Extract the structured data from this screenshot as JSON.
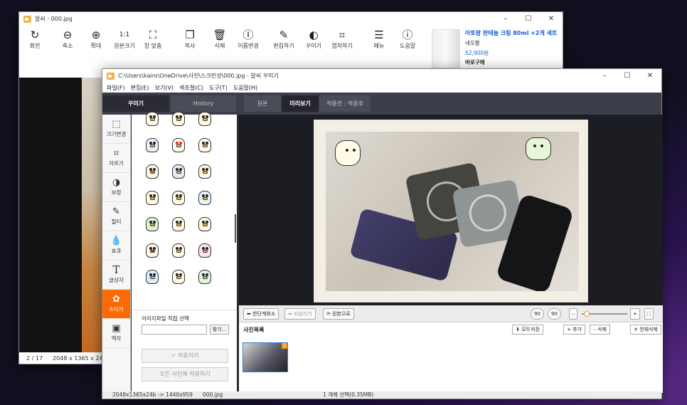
{
  "back_window": {
    "title": "알씨 - 000.jpg",
    "controls": [
      "–",
      "☐",
      "✕"
    ],
    "toolbar": [
      {
        "label": "회전",
        "icon": "rotate-icon",
        "glyph": "↻"
      },
      {
        "label": "축소",
        "icon": "zoom-out-icon",
        "glyph": "⊖"
      },
      {
        "label": "확대",
        "icon": "zoom-in-icon",
        "glyph": "⊕"
      },
      {
        "label": "원본크기",
        "icon": "original-size-icon",
        "glyph": "1:1"
      },
      {
        "label": "창 맞춤",
        "icon": "fit-window-icon",
        "glyph": "⛶"
      },
      {
        "label": "복사",
        "icon": "copy-icon",
        "glyph": "❐"
      },
      {
        "label": "삭제",
        "icon": "trash-icon",
        "glyph": "🗑"
      },
      {
        "label": "이름변경",
        "icon": "rename-icon",
        "glyph": "Ⓘ"
      },
      {
        "label": "편집하기",
        "icon": "edit-icon",
        "glyph": "✎"
      },
      {
        "label": "꾸미기",
        "icon": "palette-icon",
        "glyph": "◐"
      },
      {
        "label": "캡처하기",
        "icon": "crop-icon",
        "glyph": "⌗"
      },
      {
        "label": "메뉴",
        "icon": "menu-icon",
        "glyph": "☰"
      },
      {
        "label": "도움말",
        "icon": "info-icon",
        "glyph": "ⓘ"
      }
    ],
    "ad": {
      "title": "아토팜 판테놀 크림 80ml ×2개 세트",
      "brand": "네오팜",
      "price": "52,900원",
      "tag": "바로구매"
    },
    "status": {
      "page": "2 / 17",
      "size": "2048 x 1365 x 24"
    }
  },
  "front_window": {
    "title": "C:\\Users\\kairo\\OneDrive\\사진\\스크린샷\\000.jpg - 알씨 꾸미기",
    "controls": [
      "–",
      "☐",
      "✕"
    ],
    "menu": [
      "파일(F)",
      "편집(E)",
      "보기(V)",
      "색조절(C)",
      "도구(T)",
      "도움말(H)"
    ],
    "panel_tabs": [
      "꾸미기",
      "History"
    ],
    "view_tabs": [
      "원본",
      "미리보기",
      "적용전 : 적용후"
    ],
    "left_tools": [
      {
        "label": "크기변경",
        "icon": "resize-icon",
        "glyph": "⬚"
      },
      {
        "label": "자르기",
        "icon": "crop-icon",
        "glyph": "⌗"
      },
      {
        "label": "보정",
        "icon": "adjust-icon",
        "glyph": "◑"
      },
      {
        "label": "필터",
        "icon": "filter-icon",
        "glyph": "✎"
      },
      {
        "label": "효과",
        "icon": "effect-icon",
        "glyph": "💧"
      },
      {
        "label": "글상자",
        "icon": "text-icon",
        "glyph": "T"
      },
      {
        "label": "스티커",
        "icon": "sticker-icon",
        "glyph": "✿"
      },
      {
        "label": "액자",
        "icon": "frame-icon",
        "glyph": "▣"
      }
    ],
    "direct_select_label": "이미지파일 직접 선택",
    "browse_btn": "찾기...",
    "apply_btn": "적용하기",
    "apply_all_btn": "모든 사진에 적용하기",
    "undo_btn": "한단계취소",
    "redo_btn": "되살리기",
    "original_btn": "원본으로",
    "rotate_left": "90",
    "rotate_right": "90",
    "list_title": "사진목록",
    "save_all_btn": "모두저장",
    "add_btn": "+ 추가",
    "delete_btn": "– 삭제",
    "delete_all_btn": "✕ 전체삭제",
    "thumb_badge": "1",
    "status": {
      "resize": "2048x1365x24b -> 1440x959",
      "file": "000.jpg",
      "selection": "1 개체 선택(0.35MB)"
    }
  }
}
